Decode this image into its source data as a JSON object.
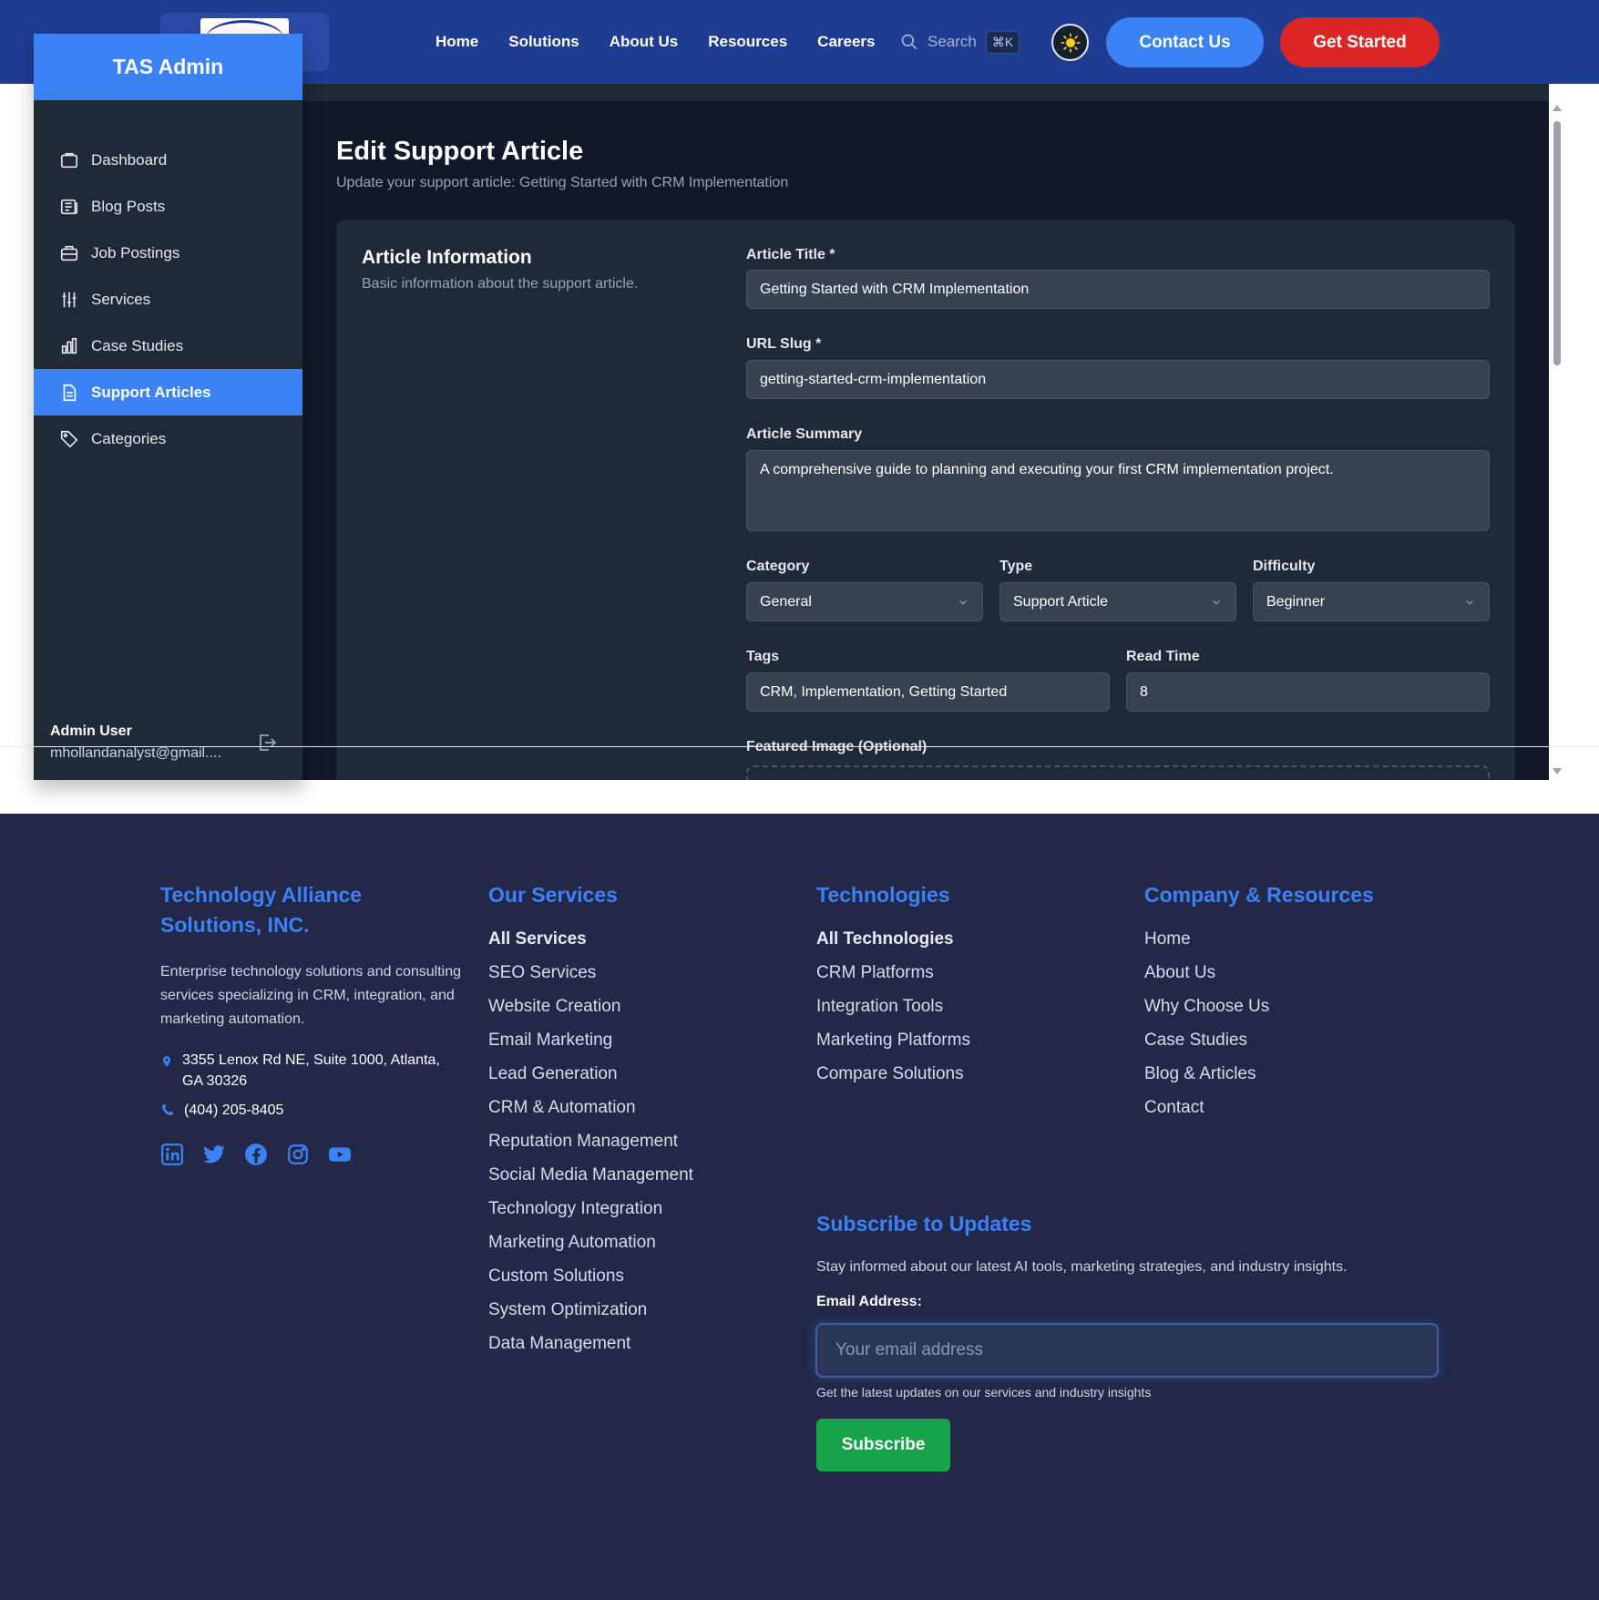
{
  "nav": {
    "links": [
      "Home",
      "Solutions",
      "About Us",
      "Resources",
      "Careers"
    ],
    "search_placeholder": "Search",
    "search_shortcut": "⌘K",
    "contact_label": "Contact Us",
    "get_started_label": "Get Started"
  },
  "sidebar": {
    "title": "TAS Admin",
    "items": [
      {
        "label": "Dashboard",
        "icon": "folder-icon"
      },
      {
        "label": "Blog Posts",
        "icon": "newspaper-icon"
      },
      {
        "label": "Job Postings",
        "icon": "briefcase-icon"
      },
      {
        "label": "Services",
        "icon": "sliders-icon"
      },
      {
        "label": "Case Studies",
        "icon": "bar-chart-icon"
      },
      {
        "label": "Support Articles",
        "icon": "document-icon",
        "active": true
      },
      {
        "label": "Categories",
        "icon": "tag-icon"
      }
    ],
    "user_name": "Admin User",
    "user_email": "mhollandanalyst@gmail...."
  },
  "page": {
    "title": "Edit Support Article",
    "subtitle": "Update your support article: Getting Started with CRM Implementation"
  },
  "form": {
    "section_title": "Article Information",
    "section_subtitle": "Basic information about the support article.",
    "title_label": "Article Title *",
    "title_value": "Getting Started with CRM Implementation",
    "slug_label": "URL Slug *",
    "slug_value": "getting-started-crm-implementation",
    "summary_label": "Article Summary",
    "summary_value": "A comprehensive guide to planning and executing your first CRM implementation project.",
    "category_label": "Category",
    "category_value": "General",
    "type_label": "Type",
    "type_value": "Support Article",
    "difficulty_label": "Difficulty",
    "difficulty_value": "Beginner",
    "tags_label": "Tags",
    "tags_value": "CRM, Implementation, Getting Started",
    "readtime_label": "Read Time",
    "readtime_value": "8",
    "image_label": "Featured Image (Optional)"
  },
  "footer": {
    "company_name": "Technology Alliance Solutions, INC.",
    "company_desc": "Enterprise technology solutions and consulting services specializing in CRM, integration, and marketing automation.",
    "address": "3355 Lenox Rd NE, Suite 1000, Atlanta, GA 30326",
    "phone": "(404) 205-8405",
    "socials": [
      "linkedin-icon",
      "twitter-icon",
      "facebook-icon",
      "instagram-icon",
      "youtube-icon"
    ],
    "services_title": "Our Services",
    "services": [
      "All Services",
      "SEO Services",
      "Website Creation",
      "Email Marketing",
      "Lead Generation",
      "CRM & Automation",
      "Reputation Management",
      "Social Media Management",
      "Technology Integration",
      "Marketing Automation",
      "Custom Solutions",
      "System Optimization",
      "Data Management"
    ],
    "tech_title": "Technologies",
    "tech": [
      "All Technologies",
      "CRM Platforms",
      "Integration Tools",
      "Marketing Platforms",
      "Compare Solutions"
    ],
    "company_title": "Company & Resources",
    "company_links": [
      "Home",
      "About Us",
      "Why Choose Us",
      "Case Studies",
      "Blog & Articles",
      "Contact"
    ],
    "subscribe_title": "Subscribe to Updates",
    "subscribe_desc": "Stay informed about our latest AI tools, marketing strategies, and industry insights.",
    "email_label": "Email Address:",
    "email_placeholder": "Your email address",
    "email_hint": "Get the latest updates on our services and industry insights",
    "subscribe_label": "Subscribe"
  },
  "colors": {
    "nav_bg": "#1f3c93",
    "accent_blue": "#3b82f6",
    "accent_red": "#dc2626",
    "subscribe_green": "#16a34a",
    "admin_bg": "#111827",
    "card_bg": "#1f2937",
    "footer_bg": "#232848"
  }
}
